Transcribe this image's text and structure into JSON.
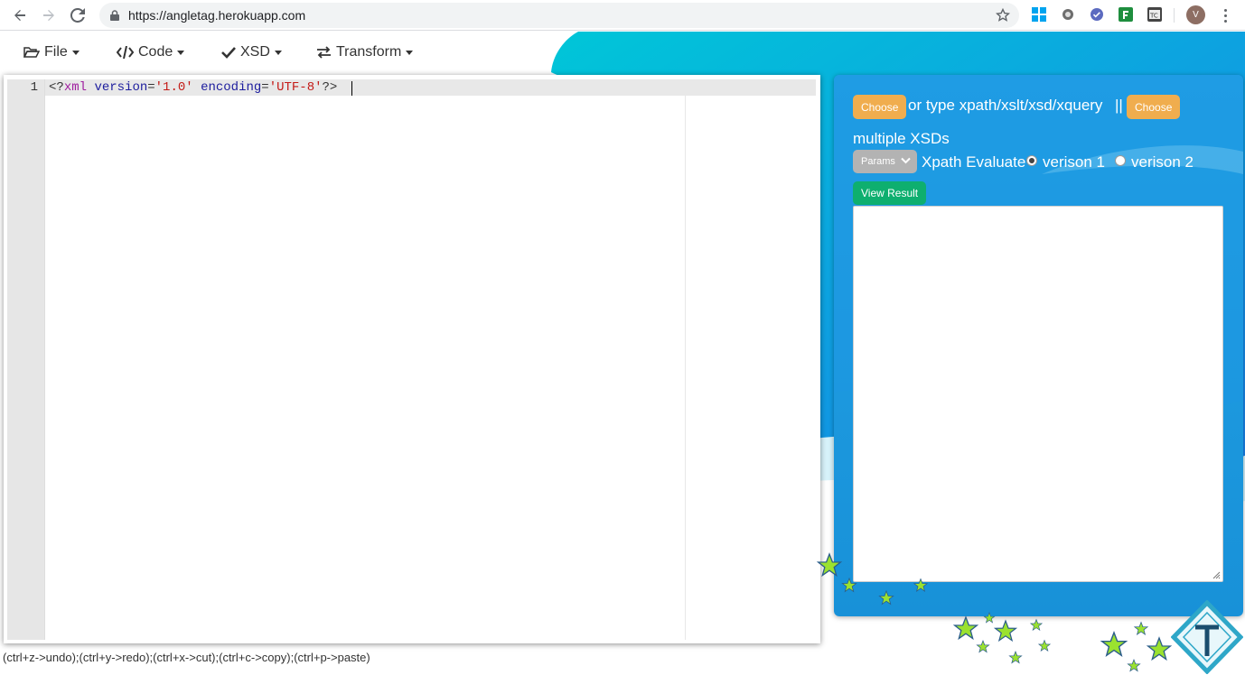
{
  "browser": {
    "url": "https://angletag.herokuapp.com",
    "avatar_letter": "V"
  },
  "toolbar": {
    "file_label": "File",
    "code_label": "Code",
    "xsd_label": "XSD",
    "transform_label": "Transform"
  },
  "editor": {
    "line_number": "1",
    "code": {
      "open": "<?",
      "tag": "xml",
      "attr1": "version",
      "eq1": "=",
      "val1": "'1.0'",
      "attr2": "encoding",
      "eq2": "=",
      "val2": "'UTF-8'",
      "close": "?>"
    }
  },
  "panel": {
    "choose_label": "Choose",
    "type_text": "or type xpath/xslt/xsd/xquery",
    "separator": "||",
    "choose2_label": "Choose",
    "multiple_xsds": "multiple XSDs",
    "params_label": "Params",
    "xpath_evaluate": "Xpath Evaluate",
    "version1_label": "verison 1",
    "version2_label": "verison 2",
    "version_selected": "verison 1",
    "view_result_label": "View Result",
    "result_value": ""
  },
  "hint": "(ctrl+z->undo);(ctrl+y->redo);(ctrl+x->cut);(ctrl+c->copy);(ctrl+p->paste)",
  "colors": {
    "panel_blue": "#1891d8",
    "choose_orange": "#f0ad4e",
    "view_result_green": "#0eaf6f",
    "params_gray": "#b3b3b3"
  }
}
